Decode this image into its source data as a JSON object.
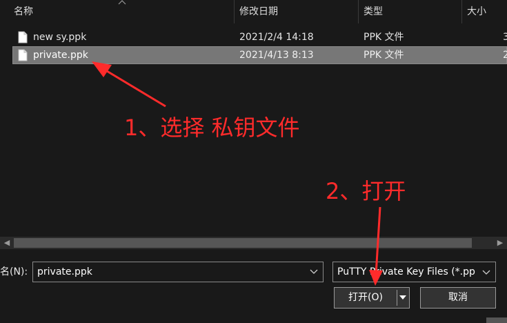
{
  "columns": {
    "name": "名称",
    "modified": "修改日期",
    "type": "类型",
    "size": "大小"
  },
  "files": [
    {
      "name": "new sy.ppk",
      "modified": "2021/2/4 14:18",
      "type": "PPK 文件",
      "size": "3",
      "selected": false,
      "icon": "file-icon"
    },
    {
      "name": "private.ppk",
      "modified": "2021/4/13 8:13",
      "type": "PPK 文件",
      "size": "2",
      "selected": true,
      "icon": "file-icon"
    }
  ],
  "annotations": {
    "step1": "1、选择 私钥文件",
    "step2": "2、打开",
    "color": "#ff2b2b"
  },
  "footer": {
    "filename_label": "名(N):",
    "filename_value": "private.ppk",
    "filter_value": "PuTTY Private Key Files (*.pp",
    "open_label": "打开(O)",
    "cancel_label": "取消"
  },
  "colors": {
    "background": "#191919",
    "selected_row": "#777777",
    "button": "#333333"
  }
}
